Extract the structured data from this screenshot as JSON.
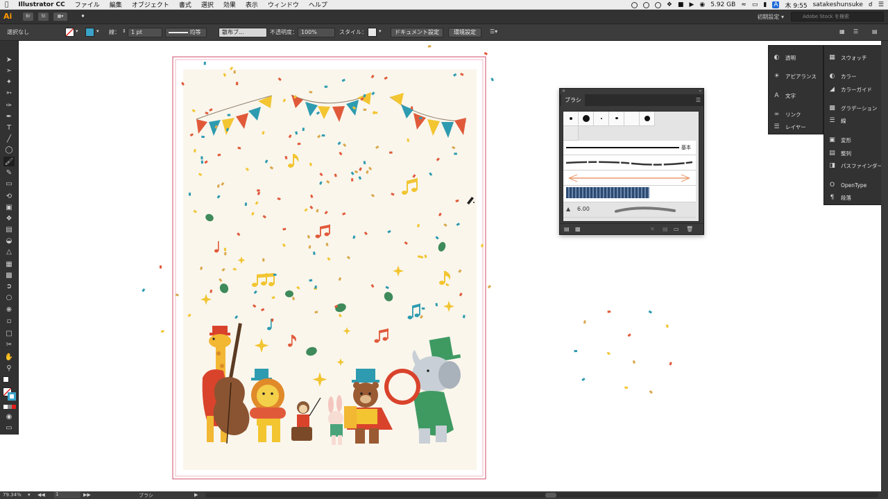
{
  "menubar": {
    "app_name": "Illustrator CC",
    "menus": [
      "ファイル",
      "編集",
      "オブジェクト",
      "書式",
      "選択",
      "効果",
      "表示",
      "ウィンドウ",
      "ヘルプ"
    ],
    "disk": "5.92 GB",
    "input_indicator": "A",
    "clock": "木 9:55",
    "user": "satakeshunsuke"
  },
  "appbar": {
    "logo": "Ai",
    "bridge": "Br",
    "stock": "St",
    "workspace": "初期設定",
    "stock_search_placeholder": "Adobe Stock を検索"
  },
  "controlbar": {
    "selection": "選択なし",
    "stroke_label": "線：",
    "stroke_weight": "1 pt",
    "stroke_profile": "均等",
    "brush": "散布ブ...",
    "opacity_label": "不透明度：",
    "opacity": "100%",
    "style_label": "スタイル：",
    "doc_setup": "ドキュメント設定",
    "prefs": "環境設定"
  },
  "dock_left": [
    {
      "icon": "transparency-icon",
      "label": "透明"
    },
    {
      "icon": "appearance-icon",
      "label": "アピアランス"
    },
    {
      "icon": "character-icon",
      "label": "文字"
    },
    {
      "icon": "link-icon",
      "label": "リンク"
    },
    {
      "icon": "layers-icon",
      "label": "レイヤー"
    }
  ],
  "dock_right": [
    {
      "icon": "swatches-icon",
      "label": "スウォッチ"
    },
    {
      "icon": "color-icon",
      "label": "カラー"
    },
    {
      "icon": "color-guide-icon",
      "label": "カラーガイド"
    },
    {
      "icon": "gradient-icon",
      "label": "グラデーション"
    },
    {
      "icon": "stroke-icon",
      "label": "線"
    },
    {
      "icon": "transform-icon",
      "label": "変形"
    },
    {
      "icon": "align-icon",
      "label": "整列"
    },
    {
      "icon": "pathfinder-icon",
      "label": "パスファインダー"
    },
    {
      "icon": "opentype-icon",
      "label": "OpenType"
    },
    {
      "icon": "paragraph-icon",
      "label": "段落"
    }
  ],
  "brush_panel": {
    "title": "ブラシ",
    "basic_label": "基本",
    "size_value": "6.00"
  },
  "statusbar": {
    "zoom": "79.34%",
    "artboard": "1",
    "tool": "ブラシ"
  },
  "colors": {
    "menubar_bg": "#ececec",
    "ui_dark": "#323232",
    "artboard_bg": "#faf6ec",
    "flag_red": "#e05a3a",
    "flag_teal": "#2e9bb0",
    "flag_yellow": "#f2c531",
    "leaf_green": "#3f8a5a"
  }
}
